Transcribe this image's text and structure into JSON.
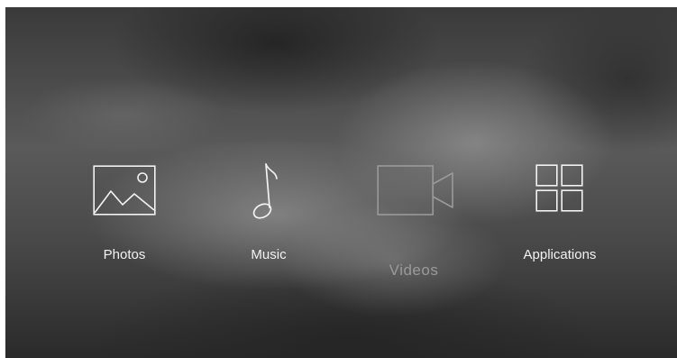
{
  "menu": {
    "items": [
      {
        "label": "Photos",
        "icon": "photo-icon",
        "state": "normal"
      },
      {
        "label": "Music",
        "icon": "music-note-icon",
        "state": "normal"
      },
      {
        "label": "Videos",
        "icon": "video-camera-icon",
        "state": "selected"
      },
      {
        "label": "Applications",
        "icon": "apps-grid-icon",
        "state": "normal"
      }
    ]
  },
  "colors": {
    "label": "#f2f2f2",
    "selected_label": "#9a9a9a",
    "icon_stroke": "#f2f2f2",
    "selected_icon_stroke": "#9a9a9a"
  }
}
